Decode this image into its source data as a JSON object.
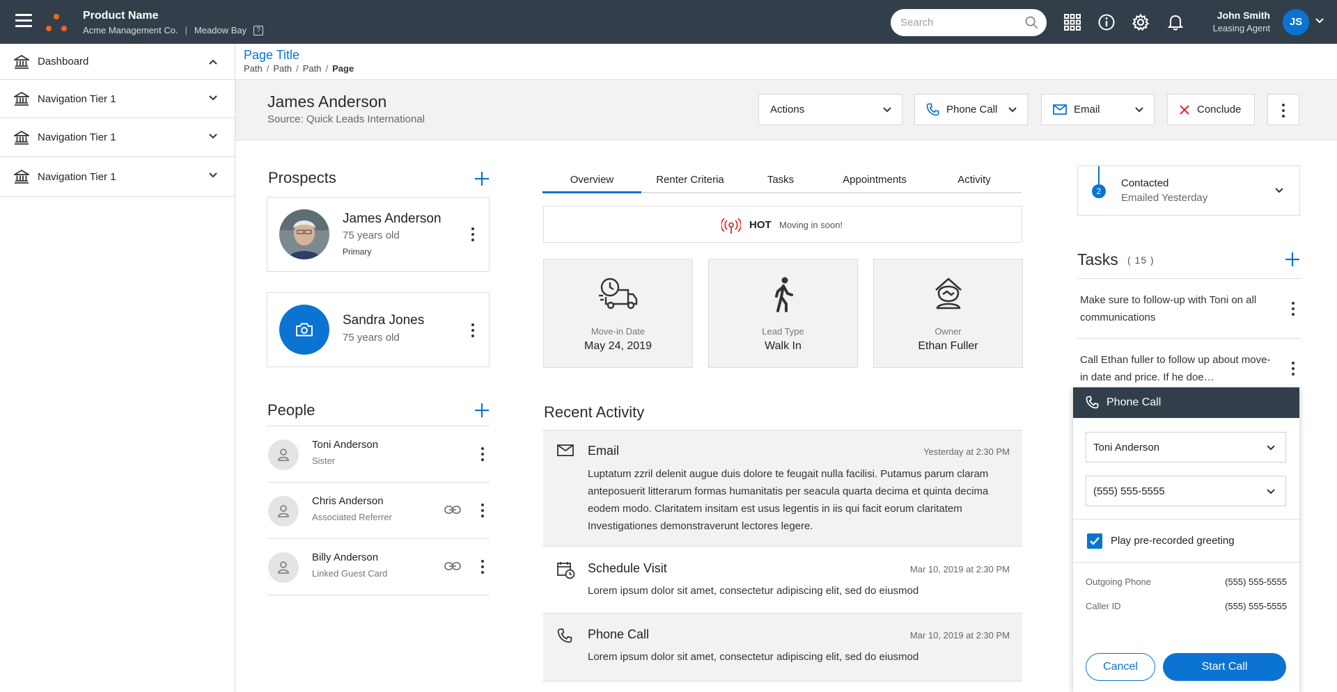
{
  "header": {
    "product_name": "Product Name",
    "company": "Acme Management Co.",
    "property": "Meadow Bay",
    "help_glyph": "?",
    "search_placeholder": "Search",
    "user_name": "John Smith",
    "user_role": "Leasing Agent",
    "user_initials": "JS"
  },
  "sidebar": {
    "items": [
      {
        "label": "Dashboard"
      },
      {
        "label": "Navigation Tier 1"
      },
      {
        "label": "Navigation Tier 1"
      },
      {
        "label": "Navigation Tier 1"
      }
    ]
  },
  "page": {
    "title": "Page Title",
    "breadcrumb": [
      "Path",
      "Path",
      "Path",
      "Page"
    ]
  },
  "lead": {
    "name": "James Anderson",
    "source": "Source: Quick Leads International",
    "actions_label": "Actions",
    "phone_label": "Phone Call",
    "email_label": "Email",
    "conclude_label": "Conclude"
  },
  "prospects": {
    "title": "Prospects",
    "items": [
      {
        "name": "James Anderson",
        "age": "75 years old",
        "tag": "Primary"
      },
      {
        "name": "Sandra Jones",
        "age": "75 years old"
      }
    ]
  },
  "people": {
    "title": "People",
    "items": [
      {
        "name": "Toni Anderson",
        "role": "Sister"
      },
      {
        "name": "Chris Anderson",
        "role": "Associated Referrer"
      },
      {
        "name": "Billy Anderson",
        "role": "Linked Guest Card"
      }
    ]
  },
  "tabs": [
    "Overview",
    "Renter Criteria",
    "Tasks",
    "Appointments",
    "Activity"
  ],
  "hot": {
    "label": "HOT",
    "sub": "Moving in soon!"
  },
  "stats": [
    {
      "label": "Move-in Date",
      "value": "May 24, 2019",
      "icon": "moving-truck-icon"
    },
    {
      "label": "Lead Type",
      "value": "Walk In",
      "icon": "walking-person-icon"
    },
    {
      "label": "Owner",
      "value": "Ethan Fuller",
      "icon": "owner-icon"
    }
  ],
  "recent_activity": {
    "title": "Recent Activity",
    "items": [
      {
        "title": "Email",
        "time": "Yesterday at 2:30 PM",
        "body": "Luptatum zzril delenit augue duis dolore te feugait nulla facilisi. Putamus parum claram anteposuerit litterarum formas humanitatis per seacula quarta decima et quinta decima eodem modo. Claritatem insitam est usus legentis in iis qui facit eorum claritatem Investigationes demonstraverunt lectores legere."
      },
      {
        "title": "Schedule Visit",
        "time": "Mar 10, 2019 at 2:30 PM",
        "body": "Lorem ipsum dolor sit amet, consectetur adipiscing elit, sed do eiusmod"
      },
      {
        "title": "Phone Call",
        "time": "Mar 10, 2019 at 2:30 PM",
        "body": "Lorem ipsum dolor sit amet, consectetur adipiscing elit, sed do eiusmod"
      }
    ]
  },
  "status": {
    "step": "2",
    "main": "Contacted",
    "sub": "Emailed Yesterday"
  },
  "tasks": {
    "title": "Tasks",
    "count": "( 15 )",
    "items": [
      {
        "text": "Make sure to follow-up with Toni on all communications"
      },
      {
        "text": "Call Ethan fuller to follow up about move-in date and price. If he doe…"
      }
    ]
  },
  "call_panel": {
    "title": "Phone Call",
    "contact": "Toni Anderson",
    "number": "(555) 555-5555",
    "greeting_label": "Play pre-recorded greeting",
    "greeting_checked": true,
    "outgoing_label": "Outgoing Phone",
    "outgoing_value": "(555) 555-5555",
    "caller_id_label": "Caller ID",
    "caller_id_value": "(555) 555-5555",
    "cancel_label": "Cancel",
    "start_label": "Start Call"
  },
  "colors": {
    "accent": "#0b73d1",
    "topbar": "#323f4b",
    "hot": "#d92b2b",
    "logo": "#f26522"
  }
}
